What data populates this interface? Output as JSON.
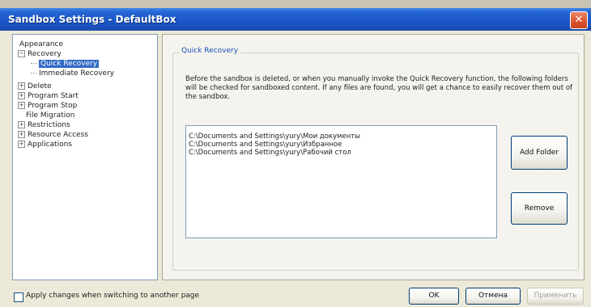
{
  "window": {
    "title": "Sandbox Settings - DefaultBox",
    "close_glyph": "✕"
  },
  "tree": {
    "items": [
      {
        "label": "Appearance",
        "expander": "",
        "indent": 0
      },
      {
        "label": "Recovery",
        "expander": "−",
        "indent": 0
      },
      {
        "label": "Quick Recovery",
        "expander": "",
        "indent": 1,
        "selected": true
      },
      {
        "label": "Immediate Recovery",
        "expander": "",
        "indent": 1
      },
      {
        "label": "Delete",
        "expander": "+",
        "indent": 0
      },
      {
        "label": "Program Start",
        "expander": "+",
        "indent": 0
      },
      {
        "label": "Program Stop",
        "expander": "+",
        "indent": 0
      },
      {
        "label": "File Migration",
        "expander": "",
        "indent": 0
      },
      {
        "label": "Restrictions",
        "expander": "+",
        "indent": 0
      },
      {
        "label": "Resource Access",
        "expander": "+",
        "indent": 0
      },
      {
        "label": "Applications",
        "expander": "+",
        "indent": 0
      }
    ]
  },
  "content": {
    "group_label": "Quick Recovery",
    "description": "Before the sandbox is deleted, or when you manually invoke the Quick Recovery function, the following folders will be checked for sandboxed content.  If any files are found, you will get a chance to easily recover them out of the sandbox.",
    "folders": [
      "C:\\Documents and Settings\\yury\\Мои документы",
      "C:\\Documents and Settings\\yury\\Избранное",
      "C:\\Documents and Settings\\yury\\Рабочий стол"
    ],
    "add_folder_label": "Add Folder",
    "remove_label": "Remove"
  },
  "footer": {
    "apply_on_switch_label": "Apply changes when switching to another page",
    "ok_label": "OK",
    "cancel_label": "Отмена",
    "apply_label": "Применить"
  },
  "colors": {
    "titlebar": "#1c57c9",
    "selection": "#316ac5",
    "group_label": "#1a50bb"
  }
}
